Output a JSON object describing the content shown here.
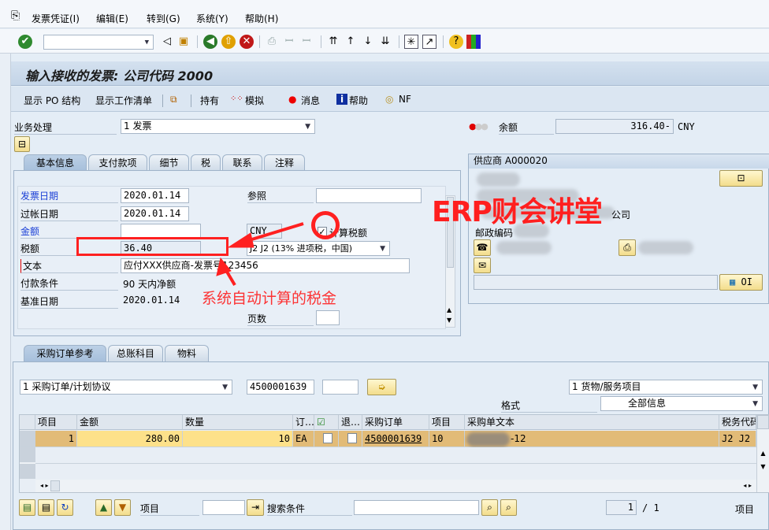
{
  "menu": {
    "items": [
      "发票凭证(I)",
      "编辑(E)",
      "转到(G)",
      "系统(Y)",
      "帮助(H)"
    ]
  },
  "toolbar": {
    "command_value": "",
    "icons": [
      "enter-icon",
      "save-icon",
      "back-icon",
      "exit-icon",
      "cancel-icon",
      "print-icon",
      "find-icon",
      "find-next-icon",
      "first-page-icon",
      "prev-page-icon",
      "next-page-icon",
      "last-page-icon",
      "new-session-icon",
      "shortcut-icon",
      "help-icon",
      "layout-icon"
    ]
  },
  "title": "输入接收的发票: 公司代码 2000",
  "app_toolbar": {
    "show_po": "显示 PO 结构",
    "show_worklist": "显示工作清单",
    "hold": "持有",
    "simulate": "模拟",
    "messages": "消息",
    "help": "帮助",
    "nf": "NF"
  },
  "transaction": {
    "label": "业务处理",
    "value": "1 发票"
  },
  "balance": {
    "label": "余额",
    "value": "316.40-",
    "currency": "CNY",
    "status_color": "#e00000"
  },
  "header_tabs": [
    "基本信息",
    "支付款项",
    "细节",
    "税",
    "联系",
    "注释"
  ],
  "basic": {
    "invoice_date_label": "发票日期",
    "invoice_date": "2020.01.14",
    "reference_label": "参照",
    "reference": "",
    "posting_date_label": "过帐日期",
    "posting_date": "2020.01.14",
    "amount_label": "金额",
    "amount": "",
    "currency": "CNY",
    "calc_tax_label": "计算税额",
    "calc_tax_checked": true,
    "tax_label": "税额",
    "tax": "36.40",
    "tax_code": "J2 J2 (13% 进项税，中国)",
    "text_label": "文本",
    "text": "应付XXX供应商-发票号123456",
    "payment_terms_label": "付款条件",
    "payment_terms": "90 天内净额",
    "baseline_label": "基准日期",
    "baseline": "2020.01.14",
    "pages_label": "页数",
    "pages": ""
  },
  "vendor": {
    "title": "供应商 A000020",
    "company_suffix": "公司",
    "postal_label": "邮政编码",
    "oi_label": "OI"
  },
  "annotations": {
    "watermark": "ERP财会讲堂",
    "note": "系统自动计算的税金",
    "color": "#ff2020"
  },
  "item_tabs": [
    "采购订单参考",
    "总账科目",
    "物料"
  ],
  "po_ref": {
    "doc_type": "1 采购订单/计划协议",
    "po_number": "4500001639",
    "extra": "",
    "item_type": "1 货物/服务项目",
    "layout_label": "格式",
    "layout": "全部信息"
  },
  "table": {
    "columns": [
      "项目",
      "金额",
      "数量",
      "订…",
      "",
      "退…",
      "采购订单",
      "项目",
      "采购单文本",
      "税务代码"
    ],
    "rows": [
      {
        "item": "1",
        "amount": "280.00",
        "qty": "10",
        "unit": "EA",
        "po": "4500001639",
        "po_item": "10",
        "text": "-12",
        "tax": "J2 J2"
      }
    ]
  },
  "bottom": {
    "item_label": "项目",
    "item_value": "",
    "search_label": "搜索条件",
    "search_value": "",
    "page_current": "1",
    "page_total": "/ 1",
    "items_label": "项目"
  }
}
